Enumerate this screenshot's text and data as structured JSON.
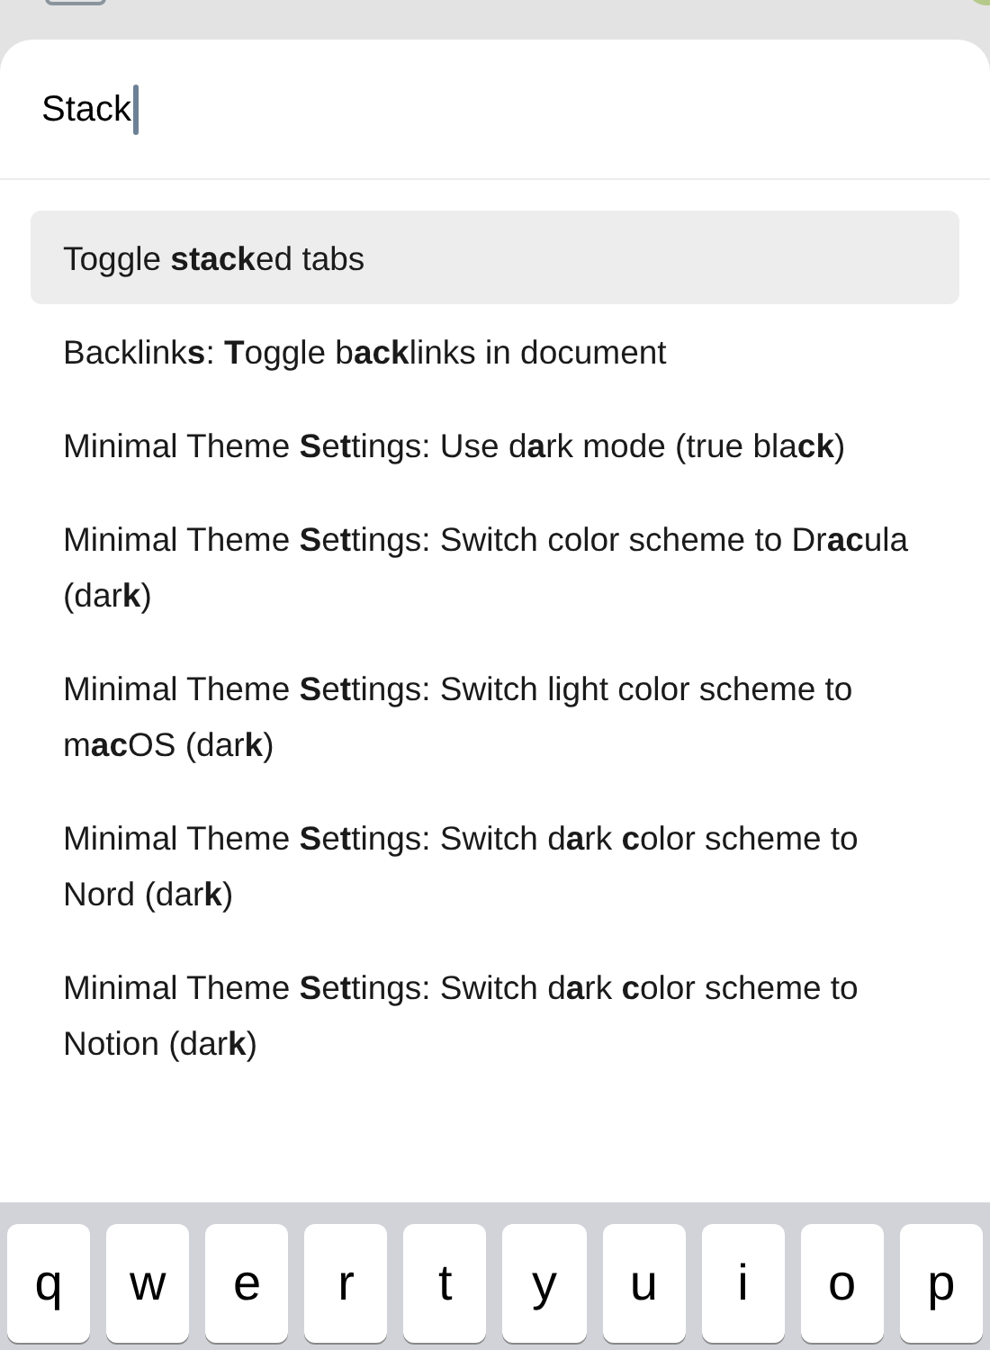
{
  "search": {
    "value": "Stack"
  },
  "results": [
    {
      "text": "Toggle **stack**ed tabs",
      "selected": true
    },
    {
      "text": "Backlink**s**: **T**oggle b**ack**links in document",
      "selected": false
    },
    {
      "text": "Minimal Theme **S**e**t**tings: Use d**a**rk mode (true bla**ck**)",
      "selected": false
    },
    {
      "text": "Minimal Theme **S**e**t**tings: Switch color scheme to Dr**ac**ula (dar**k**)",
      "selected": false
    },
    {
      "text": "Minimal Theme **S**e**t**tings: Switch light color scheme to m**ac**OS (dar**k**)",
      "selected": false
    },
    {
      "text": "Minimal Theme **S**e**t**tings: Switch d**a**rk **c**olor scheme to Nord (dar**k**)",
      "selected": false
    },
    {
      "text": "Minimal Theme **S**e**t**tings: Switch d**a**rk **c**olor scheme to Notion (dar**k**)",
      "selected": false
    }
  ],
  "keyboard": {
    "keys": [
      "q",
      "w",
      "e",
      "r",
      "t",
      "y",
      "u",
      "i",
      "o",
      "p"
    ]
  }
}
